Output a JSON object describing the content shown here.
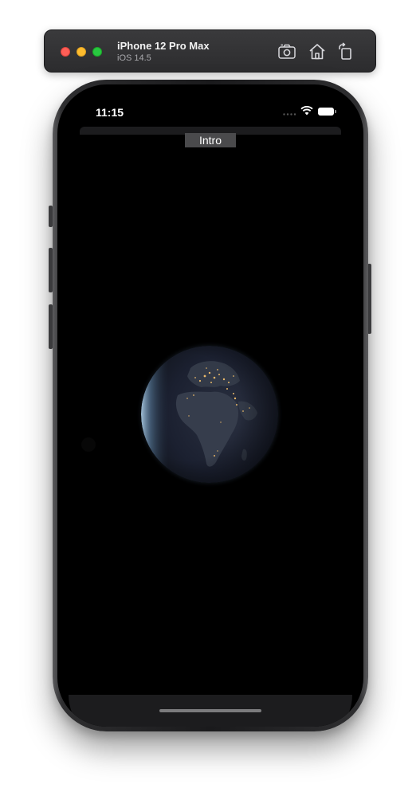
{
  "simulator": {
    "device_name": "iPhone 12 Pro Max",
    "os_version": "iOS 14.5",
    "icons": [
      "screenshot-icon",
      "home-icon",
      "rotate-icon"
    ],
    "traffic_lights": {
      "close": "#fe5f57",
      "minimize": "#febc2e",
      "zoom": "#28c840"
    }
  },
  "status_bar": {
    "time": "11:15",
    "icons": [
      "signal-dots-icon",
      "wifi-icon",
      "battery-icon"
    ]
  },
  "app": {
    "intro_label": "Intro",
    "background_color": "#000000",
    "globe_icon": "earth-night-globe"
  }
}
